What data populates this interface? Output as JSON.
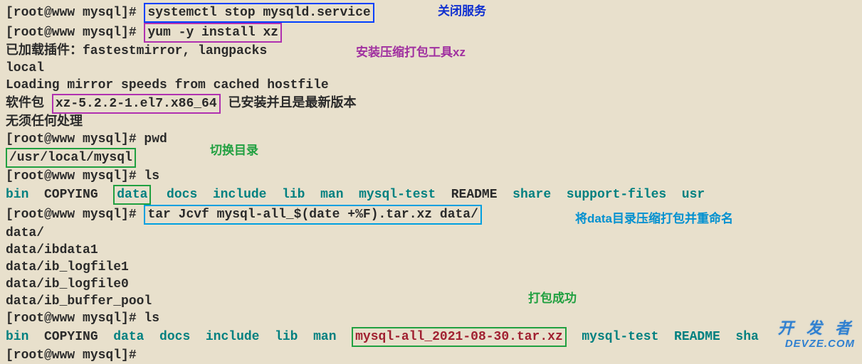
{
  "lines": {
    "l1_prompt": "[root@www mysql]# ",
    "l1_cmd": "systemctl stop mysqld.service",
    "l2_prompt": "[root@www mysql]# ",
    "l2_cmd": "yum -y install xz",
    "l3": "已加载插件：fastestmirror, langpacks",
    "l4": "local",
    "l5": "Loading mirror speeds from cached hostfile",
    "l6_a": "软件包 ",
    "l6_pkg": "xz-5.2.2-1.el7.x86_64",
    "l6_b": " 已安装并且是最新版本",
    "l7": "无须任何处理",
    "l8": "[root@www mysql]# pwd",
    "l9": "/usr/local/mysql",
    "l10": "[root@www mysql]# ls",
    "l11_bin": "bin",
    "l11_copying": "  COPYING  ",
    "l11_data": "data",
    "l11_rest": "  docs  include  lib  man  mysql-test",
    "l11_readme": "  README  ",
    "l11_share": "share  support-files  usr",
    "l12_prompt": "[root@www mysql]# ",
    "l12_cmd": "tar Jcvf mysql-all_$(date +%F).tar.xz data/",
    "l13": "data/",
    "l14": "data/ibdata1",
    "l15": "data/ib_logfile1",
    "l16": "data/ib_logfile0",
    "l17": "data/ib_buffer_pool",
    "l18": "[root@www mysql]# ls",
    "l19_bin": "bin",
    "l19_copying": "  COPYING  ",
    "l19_data": "data",
    "l19_mid": "  docs  include  lib  man  ",
    "l19_tarfile": "mysql-all_2021-08-30.tar.xz",
    "l19_rest": "  mysql-test  README  sha",
    "l20": "[root@www mysql]#"
  },
  "annotations": {
    "a1": "关闭服务",
    "a2": "安装压缩打包工具xz",
    "a3": "切换目录",
    "a4": "将data目录压缩打包并重命名",
    "a5": "打包成功"
  },
  "watermark": {
    "cn": "开 发 者",
    "en": "DEVZE.COM"
  }
}
